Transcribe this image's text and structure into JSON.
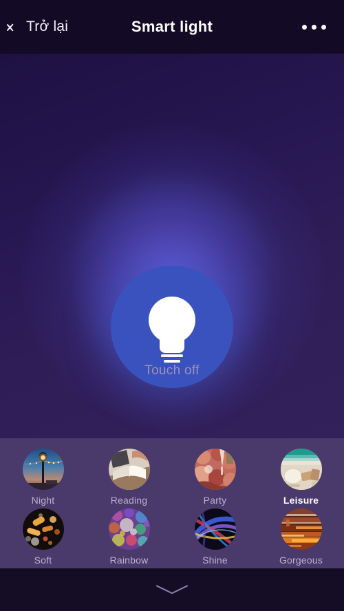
{
  "header": {
    "back_label": "Trở lại",
    "back_icon": "chevron-left-icon",
    "title": "Smart light",
    "more_icon": "more-horizontal-icon"
  },
  "main": {
    "power_icon": "light-bulb-icon",
    "status_label": "Touch off",
    "bulb_circle_color": "#3a52bd",
    "bulb_glyph_color": "#ffffff",
    "glow_color": "#5a68e0",
    "background_top_color": "#1e1142",
    "background_bottom_color": "#32215b"
  },
  "scenes": {
    "panel_color": "#4a3a6b",
    "selected": "Leisure",
    "items": [
      {
        "label": "Night",
        "thumb": "street-lamp-dusk-thumb",
        "selected": false
      },
      {
        "label": "Reading",
        "thumb": "open-book-thumb",
        "selected": false
      },
      {
        "label": "Party",
        "thumb": "party-table-thumb",
        "selected": false
      },
      {
        "label": "Leisure",
        "thumb": "beach-thumb",
        "selected": true
      },
      {
        "label": "Soft",
        "thumb": "warm-bokeh-thumb",
        "selected": false
      },
      {
        "label": "Rainbow",
        "thumb": "colorful-bubbles-thumb",
        "selected": false
      },
      {
        "label": "Shine",
        "thumb": "light-streaks-thumb",
        "selected": false
      },
      {
        "label": "Gorgeous",
        "thumb": "orange-light-trails-thumb",
        "selected": false
      }
    ]
  },
  "footer": {
    "collapse_icon": "chevron-down-icon"
  }
}
